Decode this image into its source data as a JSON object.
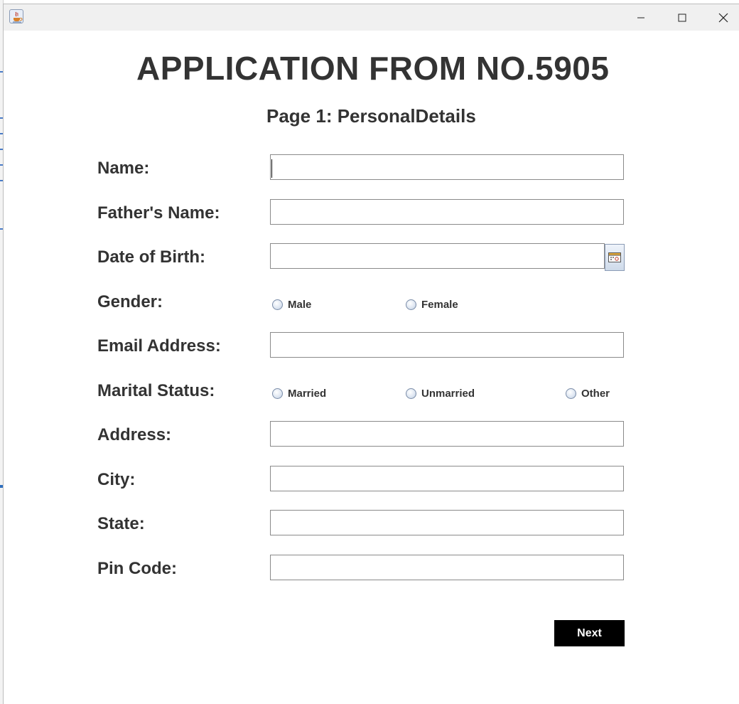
{
  "window": {
    "app_icon": "java-cup-icon",
    "controls": {
      "minimize": "minimize-icon",
      "maximize": "maximize-icon",
      "close": "close-icon"
    }
  },
  "form": {
    "title": "APPLICATION FROM NO.5905",
    "subtitle": "Page 1: PersonalDetails",
    "labels": {
      "name": "Name:",
      "father_name": "Father's Name:",
      "dob": "Date of Birth:",
      "gender": "Gender:",
      "email": "Email Address:",
      "marital_status": "Marital Status:",
      "address": "Address:",
      "city": "City:",
      "state": "State:",
      "pin_code": "Pin Code:"
    },
    "values": {
      "name": "",
      "father_name": "",
      "dob": "",
      "email": "",
      "address": "",
      "city": "",
      "state": "",
      "pin_code": ""
    },
    "gender_options": {
      "male": "Male",
      "female": "Female"
    },
    "marital_options": {
      "married": "Married",
      "unmarried": "Unmarried",
      "other": "Other"
    },
    "calendar_icon": "calendar-icon",
    "next_label": "Next"
  }
}
